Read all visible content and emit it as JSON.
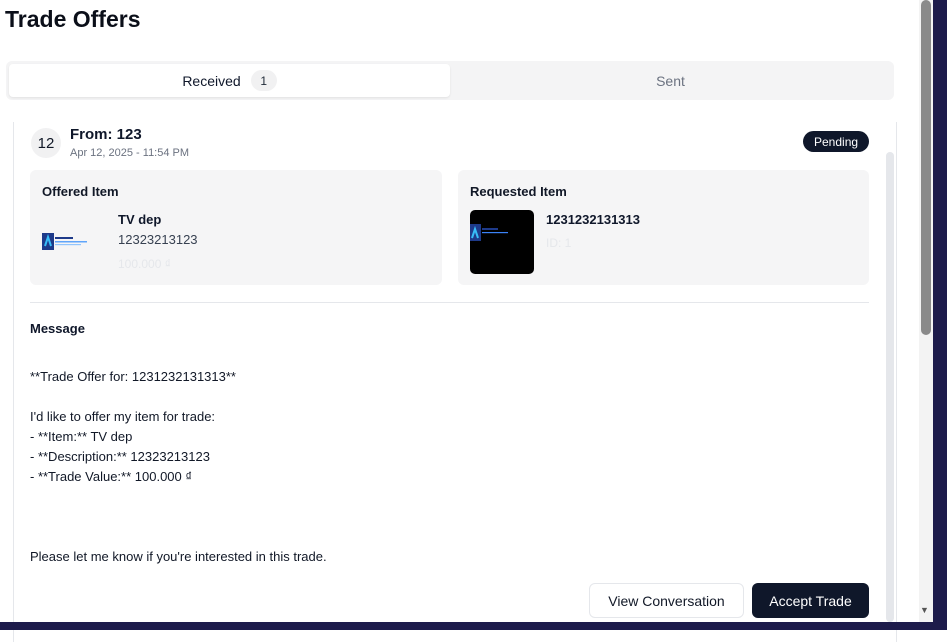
{
  "header": {
    "title": "Trade Offers"
  },
  "tabs": {
    "received_label": "Received",
    "received_count": "1",
    "sent_label": "Sent"
  },
  "offer": {
    "avatar_text": "12",
    "from": "From: 123",
    "date": "Apr 12, 2025 - 11:54 PM",
    "status": "Pending",
    "offered": {
      "heading": "Offered Item",
      "name": "TV dep",
      "description": "12323213123",
      "value": "100.000 ₫"
    },
    "requested": {
      "heading": "Requested Item",
      "name": "1231232131313",
      "id": "ID: 1"
    },
    "message": {
      "heading": "Message",
      "lines": [
        "**Trade Offer for: 1231232131313**",
        "",
        "I'd like to offer my item for trade:",
        "- **Item:** TV dep",
        "- **Description:** 12323213123",
        "- **Trade Value:** 100.000 ₫",
        "",
        "",
        "",
        "Please let me know if you're interested in this trade."
      ]
    },
    "actions": {
      "view_conversation": "View Conversation",
      "accept": "Accept Trade"
    }
  },
  "colors": {
    "primary": "#0f172a",
    "muted_bg": "#f5f5f6"
  }
}
